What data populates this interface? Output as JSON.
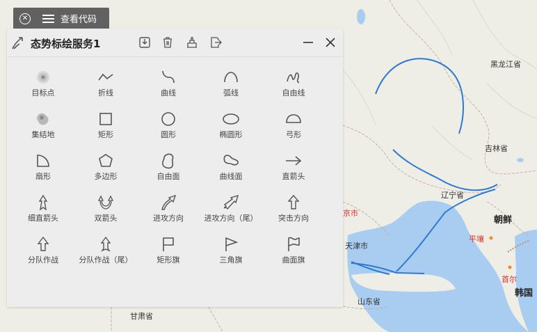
{
  "toolbar": {
    "code_label": "查看代码"
  },
  "panel": {
    "title": "态势标绘服务1",
    "tools": [
      {
        "label": "目标点",
        "icon": "target-point-icon"
      },
      {
        "label": "折线",
        "icon": "polyline-icon"
      },
      {
        "label": "曲线",
        "icon": "curve-icon"
      },
      {
        "label": "弧线",
        "icon": "arc-icon"
      },
      {
        "label": "自由线",
        "icon": "freehand-line-icon"
      },
      {
        "label": "集结地",
        "icon": "assembly-area-icon"
      },
      {
        "label": "矩形",
        "icon": "rectangle-icon"
      },
      {
        "label": "圆形",
        "icon": "circle-icon"
      },
      {
        "label": "椭圆形",
        "icon": "ellipse-icon"
      },
      {
        "label": "弓形",
        "icon": "bow-shape-icon"
      },
      {
        "label": "扇形",
        "icon": "sector-icon"
      },
      {
        "label": "多边形",
        "icon": "polygon-icon"
      },
      {
        "label": "自由面",
        "icon": "freehand-area-icon"
      },
      {
        "label": "曲线面",
        "icon": "curve-area-icon"
      },
      {
        "label": "直箭头",
        "icon": "straight-arrow-icon"
      },
      {
        "label": "细直箭头",
        "icon": "thin-straight-arrow-icon"
      },
      {
        "label": "双箭头",
        "icon": "double-arrow-icon"
      },
      {
        "label": "进攻方向",
        "icon": "attack-direction-icon"
      },
      {
        "label": "进攻方向（尾）",
        "icon": "attack-direction-tail-icon"
      },
      {
        "label": "突击方向",
        "icon": "assault-direction-icon"
      },
      {
        "label": "分队作战",
        "icon": "squad-combat-icon"
      },
      {
        "label": "分队作战（尾）",
        "icon": "squad-combat-tail-icon"
      },
      {
        "label": "矩形旗",
        "icon": "rectangle-flag-icon"
      },
      {
        "label": "三角旗",
        "icon": "triangle-flag-icon"
      },
      {
        "label": "曲面旗",
        "icon": "curved-flag-icon"
      }
    ]
  },
  "map": {
    "labels": {
      "heilongjiang": "黑龙江省",
      "jilin": "吉林省",
      "liaoning": "辽宁省",
      "north_korea": "朝鲜",
      "pyongyang": "平壤",
      "seoul": "首尔",
      "south_korea": "韩国",
      "tianjin": "天津市",
      "shandong": "山东省",
      "gansu": "甘肃省",
      "beijing_partial": "京市"
    },
    "plot_color": "#2b7bd4",
    "sea_color": "#a9cdf0"
  }
}
